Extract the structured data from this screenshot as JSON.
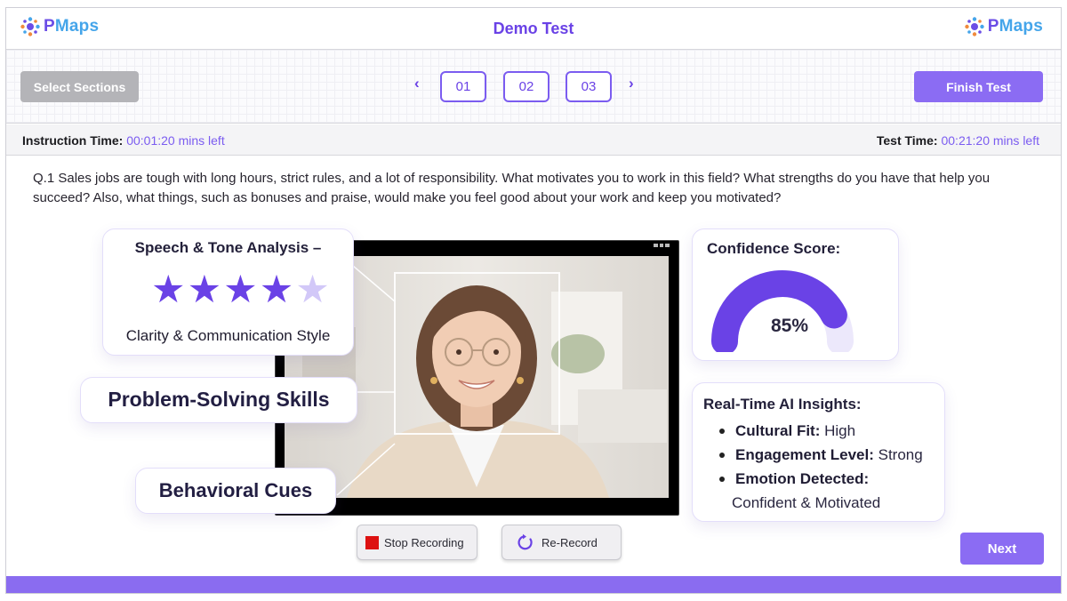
{
  "header": {
    "logo_text": "PMaps",
    "title": "Demo Test"
  },
  "toolbar": {
    "select_sections_label": "Select Sections",
    "prev_icon": "chevron-left-icon",
    "next_icon": "chevron-right-icon",
    "pages": [
      "01",
      "02",
      "03"
    ],
    "finish_label": "Finish Test"
  },
  "timers": {
    "instruction_label": "Instruction Time:",
    "instruction_value": "00:01:20 mins left",
    "test_label": "Test Time:",
    "test_value": "00:21:20 mins left"
  },
  "question": {
    "text": "Q.1 Sales jobs are tough with long hours, strict rules, and a lot of responsibility. What motivates you to work in this field? What strengths do you have that help you succeed? Also, what things, such as bonuses and praise, would make you feel good about your work and keep you motivated?"
  },
  "speech_card": {
    "title": "Speech & Tone Analysis –",
    "rating": 4,
    "rating_max": 5,
    "subtitle": "Clarity & Communication Style"
  },
  "problem_card": {
    "label": "Problem-Solving Skills"
  },
  "behavior_card": {
    "label": "Behavioral Cues"
  },
  "confidence_card": {
    "title": "Confidence Score:",
    "value": 85,
    "value_text": "85%"
  },
  "insights_card": {
    "title": "Real-Time AI Insights:",
    "items": [
      {
        "label": "Cultural Fit:",
        "value": "High"
      },
      {
        "label": "Engagement Level:",
        "value": "Strong"
      },
      {
        "label": "Emotion Detected:",
        "value": "Confident & Motivated"
      }
    ]
  },
  "recording": {
    "stop_label": "Stop Recording",
    "rerecord_label": "Re-Record"
  },
  "next_label": "Next",
  "colors": {
    "accent": "#7b5cf0",
    "accent_dark": "#6a42e6",
    "logo_blue": "#45a5ea",
    "stop_red": "#dd1111",
    "gauge_track": "#ece8fb"
  }
}
